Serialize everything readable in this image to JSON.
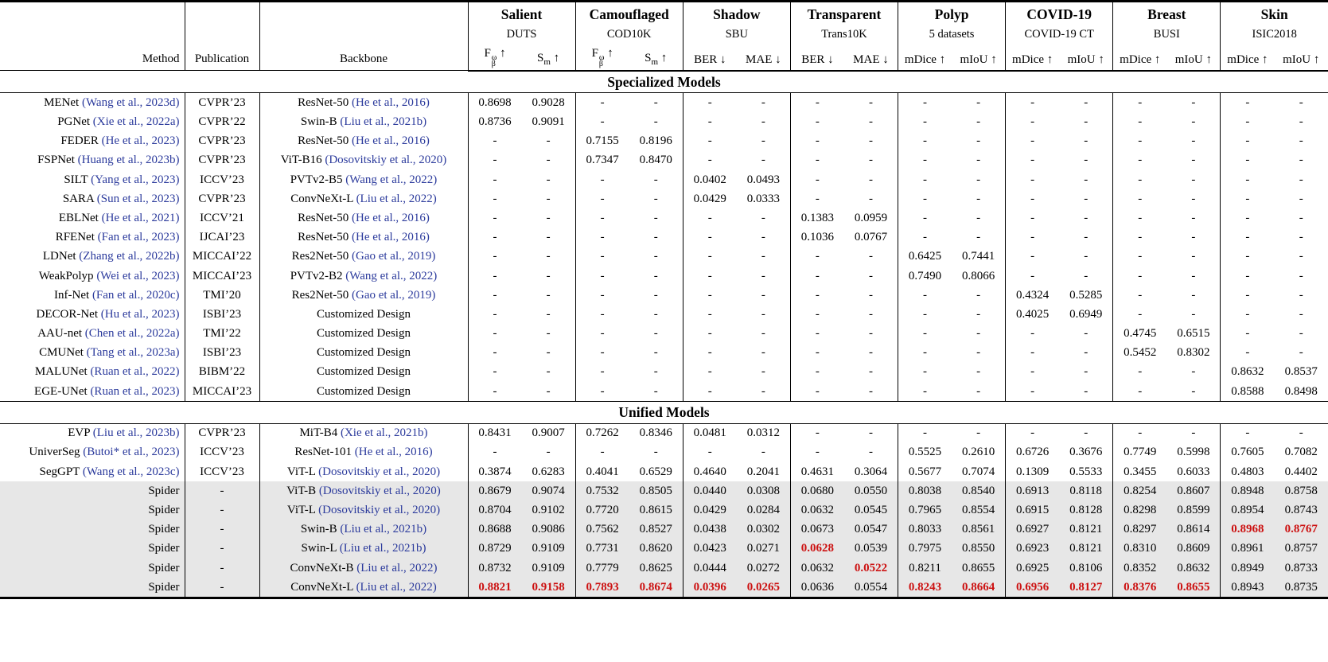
{
  "colors": {
    "cite": "#2b3a9c",
    "red": "#cc1111",
    "highlight": "#e7e7e7"
  },
  "table": {
    "left_columns": [
      {
        "label": "Method"
      },
      {
        "label": "Publication"
      },
      {
        "label": "Backbone"
      }
    ],
    "groups": [
      {
        "task": "Salient",
        "dataset": "DUTS",
        "metrics": [
          {
            "t": "F",
            "sub": "β",
            "sup": "ω",
            "arrow": "↑"
          },
          {
            "t": "S",
            "sub": "m",
            "arrow": "↑"
          }
        ]
      },
      {
        "task": "Camouflaged",
        "dataset": "COD10K",
        "metrics": [
          {
            "t": "F",
            "sub": "β",
            "sup": "ω",
            "arrow": "↑"
          },
          {
            "t": "S",
            "sub": "m",
            "arrow": "↑"
          }
        ]
      },
      {
        "task": "Shadow",
        "dataset": "SBU",
        "metrics": [
          {
            "t": "BER",
            "arrow": "↓"
          },
          {
            "t": "MAE",
            "arrow": "↓"
          }
        ]
      },
      {
        "task": "Transparent",
        "dataset": "Trans10K",
        "metrics": [
          {
            "t": "BER",
            "arrow": "↓"
          },
          {
            "t": "MAE",
            "arrow": "↓"
          }
        ]
      },
      {
        "task": "Polyp",
        "dataset": "5 datasets",
        "metrics": [
          {
            "t": "mDice",
            "arrow": "↑"
          },
          {
            "t": "mIoU",
            "arrow": "↑"
          }
        ]
      },
      {
        "task": "COVID-19",
        "dataset": "COVID-19 CT",
        "metrics": [
          {
            "t": "mDice",
            "arrow": "↑"
          },
          {
            "t": "mIoU",
            "arrow": "↑"
          }
        ]
      },
      {
        "task": "Breast",
        "dataset": "BUSI",
        "metrics": [
          {
            "t": "mDice",
            "arrow": "↑"
          },
          {
            "t": "mIoU",
            "arrow": "↑"
          }
        ]
      },
      {
        "task": "Skin",
        "dataset": "ISIC2018",
        "metrics": [
          {
            "t": "mDice",
            "arrow": "↑"
          },
          {
            "t": "mIoU",
            "arrow": "↑"
          }
        ]
      }
    ],
    "sections": [
      {
        "title": "Specialized Models",
        "rows": [
          {
            "method": "MENet",
            "method_cite": "(Wang et al., 2023d)",
            "pub": "CVPR’23",
            "backbone": "ResNet-50",
            "backbone_cite": "(He et al., 2016)",
            "values": [
              "0.8698",
              "0.9028",
              "-",
              "-",
              "-",
              "-",
              "-",
              "-",
              "-",
              "-",
              "-",
              "-",
              "-",
              "-",
              "-",
              "-"
            ]
          },
          {
            "method": "PGNet",
            "method_cite": "(Xie et al., 2022a)",
            "pub": "CVPR’22",
            "backbone": "Swin-B",
            "backbone_cite": "(Liu et al., 2021b)",
            "values": [
              "0.8736",
              "0.9091",
              "-",
              "-",
              "-",
              "-",
              "-",
              "-",
              "-",
              "-",
              "-",
              "-",
              "-",
              "-",
              "-",
              "-"
            ]
          },
          {
            "method": "FEDER",
            "method_cite": "(He et al., 2023)",
            "pub": "CVPR’23",
            "backbone": "ResNet-50",
            "backbone_cite": "(He et al., 2016)",
            "values": [
              "-",
              "-",
              "0.7155",
              "0.8196",
              "-",
              "-",
              "-",
              "-",
              "-",
              "-",
              "-",
              "-",
              "-",
              "-",
              "-",
              "-"
            ]
          },
          {
            "method": "FSPNet",
            "method_cite": "(Huang et al., 2023b)",
            "pub": "CVPR’23",
            "backbone": "ViT-B16",
            "backbone_cite": "(Dosovitskiy et al., 2020)",
            "values": [
              "-",
              "-",
              "0.7347",
              "0.8470",
              "-",
              "-",
              "-",
              "-",
              "-",
              "-",
              "-",
              "-",
              "-",
              "-",
              "-",
              "-"
            ]
          },
          {
            "method": "SILT",
            "method_cite": "(Yang et al., 2023)",
            "pub": "ICCV’23",
            "backbone": "PVTv2-B5",
            "backbone_cite": "(Wang et al., 2022)",
            "values": [
              "-",
              "-",
              "-",
              "-",
              "0.0402",
              "0.0493",
              "-",
              "-",
              "-",
              "-",
              "-",
              "-",
              "-",
              "-",
              "-",
              "-"
            ]
          },
          {
            "method": "SARA",
            "method_cite": "(Sun et al., 2023)",
            "pub": "CVPR’23",
            "backbone": "ConvNeXt-L",
            "backbone_cite": "(Liu et al., 2022)",
            "values": [
              "-",
              "-",
              "-",
              "-",
              "0.0429",
              "0.0333",
              "-",
              "-",
              "-",
              "-",
              "-",
              "-",
              "-",
              "-",
              "-",
              "-"
            ]
          },
          {
            "method": "EBLNet",
            "method_cite": "(He et al., 2021)",
            "pub": "ICCV’21",
            "backbone": "ResNet-50",
            "backbone_cite": "(He et al., 2016)",
            "values": [
              "-",
              "-",
              "-",
              "-",
              "-",
              "-",
              "0.1383",
              "0.0959",
              "-",
              "-",
              "-",
              "-",
              "-",
              "-",
              "-",
              "-"
            ]
          },
          {
            "method": "RFENet",
            "method_cite": "(Fan et al., 2023)",
            "pub": "IJCAI’23",
            "backbone": "ResNet-50",
            "backbone_cite": "(He et al., 2016)",
            "values": [
              "-",
              "-",
              "-",
              "-",
              "-",
              "-",
              "0.1036",
              "0.0767",
              "-",
              "-",
              "-",
              "-",
              "-",
              "-",
              "-",
              "-"
            ]
          },
          {
            "method": "LDNet",
            "method_cite": "(Zhang et al., 2022b)",
            "pub": "MICCAI’22",
            "backbone": "Res2Net-50",
            "backbone_cite": "(Gao et al., 2019)",
            "values": [
              "-",
              "-",
              "-",
              "-",
              "-",
              "-",
              "-",
              "-",
              "0.6425",
              "0.7441",
              "-",
              "-",
              "-",
              "-",
              "-",
              "-"
            ]
          },
          {
            "method": "WeakPolyp",
            "method_cite": "(Wei et al., 2023)",
            "pub": "MICCAI’23",
            "backbone": "PVTv2-B2",
            "backbone_cite": "(Wang et al., 2022)",
            "values": [
              "-",
              "-",
              "-",
              "-",
              "-",
              "-",
              "-",
              "-",
              "0.7490",
              "0.8066",
              "-",
              "-",
              "-",
              "-",
              "-",
              "-"
            ]
          },
          {
            "method": "Inf-Net",
            "method_cite": "(Fan et al., 2020c)",
            "pub": "TMI’20",
            "backbone": "Res2Net-50",
            "backbone_cite": "(Gao et al., 2019)",
            "values": [
              "-",
              "-",
              "-",
              "-",
              "-",
              "-",
              "-",
              "-",
              "-",
              "-",
              "0.4324",
              "0.5285",
              "-",
              "-",
              "-",
              "-"
            ]
          },
          {
            "method": "DECOR-Net",
            "method_cite": "(Hu et al., 2023)",
            "pub": "ISBI’23",
            "backbone": "Customized Design",
            "backbone_cite": "",
            "values": [
              "-",
              "-",
              "-",
              "-",
              "-",
              "-",
              "-",
              "-",
              "-",
              "-",
              "0.4025",
              "0.6949",
              "-",
              "-",
              "-",
              "-"
            ]
          },
          {
            "method": "AAU-net",
            "method_cite": "(Chen et al., 2022a)",
            "pub": "TMI’22",
            "backbone": "Customized Design",
            "backbone_cite": "",
            "values": [
              "-",
              "-",
              "-",
              "-",
              "-",
              "-",
              "-",
              "-",
              "-",
              "-",
              "-",
              "-",
              "0.4745",
              "0.6515",
              "-",
              "-"
            ]
          },
          {
            "method": "CMUNet",
            "method_cite": "(Tang et al., 2023a)",
            "pub": "ISBI’23",
            "backbone": "Customized Design",
            "backbone_cite": "",
            "values": [
              "-",
              "-",
              "-",
              "-",
              "-",
              "-",
              "-",
              "-",
              "-",
              "-",
              "-",
              "-",
              "0.5452",
              "0.8302",
              "-",
              "-"
            ]
          },
          {
            "method": "MALUNet",
            "method_cite": "(Ruan et al., 2022)",
            "pub": "BIBM’22",
            "backbone": "Customized Design",
            "backbone_cite": "",
            "values": [
              "-",
              "-",
              "-",
              "-",
              "-",
              "-",
              "-",
              "-",
              "-",
              "-",
              "-",
              "-",
              "-",
              "-",
              "0.8632",
              "0.8537"
            ]
          },
          {
            "method": "EGE-UNet",
            "method_cite": "(Ruan et al., 2023)",
            "pub": "MICCAI’23",
            "backbone": "Customized Design",
            "backbone_cite": "",
            "values": [
              "-",
              "-",
              "-",
              "-",
              "-",
              "-",
              "-",
              "-",
              "-",
              "-",
              "-",
              "-",
              "-",
              "-",
              "0.8588",
              "0.8498"
            ]
          }
        ]
      },
      {
        "title": "Unified Models",
        "rows": [
          {
            "method": "EVP",
            "method_cite": "(Liu et al., 2023b)",
            "pub": "CVPR’23",
            "backbone": "MiT-B4",
            "backbone_cite": "(Xie et al., 2021b)",
            "values": [
              "0.8431",
              "0.9007",
              "0.7262",
              "0.8346",
              "0.0481",
              "0.0312",
              "-",
              "-",
              "-",
              "-",
              "-",
              "-",
              "-",
              "-",
              "-",
              "-"
            ]
          },
          {
            "method": "UniverSeg",
            "method_cite": "(Butoi* et al., 2023)",
            "pub": "ICCV’23",
            "backbone": "ResNet-101",
            "backbone_cite": "(He et al., 2016)",
            "values": [
              "-",
              "-",
              "-",
              "-",
              "-",
              "-",
              "-",
              "-",
              "0.5525",
              "0.2610",
              "0.6726",
              "0.3676",
              "0.7749",
              "0.5998",
              "0.7605",
              "0.7082"
            ]
          },
          {
            "method": "SegGPT",
            "method_cite": "(Wang et al., 2023c)",
            "pub": "ICCV’23",
            "backbone": "ViT-L",
            "backbone_cite": "(Dosovitskiy et al., 2020)",
            "values": [
              "0.3874",
              "0.6283",
              "0.4041",
              "0.6529",
              "0.4640",
              "0.2041",
              "0.4631",
              "0.3064",
              "0.5677",
              "0.7074",
              "0.1309",
              "0.5533",
              "0.3455",
              "0.6033",
              "0.4803",
              "0.4402"
            ]
          },
          {
            "method": "Spider",
            "method_cite": "",
            "pub": "-",
            "backbone": "ViT-B",
            "backbone_cite": "(Dosovitskiy et al., 2020)",
            "highlight": true,
            "values": [
              "0.8679",
              "0.9074",
              "0.7532",
              "0.8505",
              "0.0440",
              "0.0308",
              "0.0680",
              "0.0550",
              "0.8038",
              "0.8540",
              "0.6913",
              "0.8118",
              "0.8254",
              "0.8607",
              "0.8948",
              "0.8758"
            ]
          },
          {
            "method": "Spider",
            "method_cite": "",
            "pub": "-",
            "backbone": "ViT-L",
            "backbone_cite": "(Dosovitskiy et al., 2020)",
            "highlight": true,
            "values": [
              "0.8704",
              "0.9102",
              "0.7720",
              "0.8615",
              "0.0429",
              "0.0284",
              "0.0632",
              "0.0545",
              "0.7965",
              "0.8554",
              "0.6915",
              "0.8128",
              "0.8298",
              "0.8599",
              "0.8954",
              "0.8743"
            ]
          },
          {
            "method": "Spider",
            "method_cite": "",
            "pub": "-",
            "backbone": "Swin-B",
            "backbone_cite": "(Liu et al., 2021b)",
            "highlight": true,
            "red": [
              14,
              15
            ],
            "values": [
              "0.8688",
              "0.9086",
              "0.7562",
              "0.8527",
              "0.0438",
              "0.0302",
              "0.0673",
              "0.0547",
              "0.8033",
              "0.8561",
              "0.6927",
              "0.8121",
              "0.8297",
              "0.8614",
              "0.8968",
              "0.8767"
            ]
          },
          {
            "method": "Spider",
            "method_cite": "",
            "pub": "-",
            "backbone": "Swin-L",
            "backbone_cite": "(Liu et al., 2021b)",
            "highlight": true,
            "red": [
              6
            ],
            "values": [
              "0.8729",
              "0.9109",
              "0.7731",
              "0.8620",
              "0.0423",
              "0.0271",
              "0.0628",
              "0.0539",
              "0.7975",
              "0.8550",
              "0.6923",
              "0.8121",
              "0.8310",
              "0.8609",
              "0.8961",
              "0.8757"
            ]
          },
          {
            "method": "Spider",
            "method_cite": "",
            "pub": "-",
            "backbone": "ConvNeXt-B",
            "backbone_cite": "(Liu et al., 2022)",
            "highlight": true,
            "red": [
              7
            ],
            "values": [
              "0.8732",
              "0.9109",
              "0.7779",
              "0.8625",
              "0.0444",
              "0.0272",
              "0.0632",
              "0.0522",
              "0.8211",
              "0.8655",
              "0.6925",
              "0.8106",
              "0.8352",
              "0.8632",
              "0.8949",
              "0.8733"
            ]
          },
          {
            "method": "Spider",
            "method_cite": "",
            "pub": "-",
            "backbone": "ConvNeXt-L",
            "backbone_cite": "(Liu et al., 2022)",
            "highlight": true,
            "red": [
              0,
              1,
              2,
              3,
              4,
              5,
              8,
              9,
              10,
              11,
              12,
              13
            ],
            "values": [
              "0.8821",
              "0.9158",
              "0.7893",
              "0.8674",
              "0.0396",
              "0.0265",
              "0.0636",
              "0.0554",
              "0.8243",
              "0.8664",
              "0.6956",
              "0.8127",
              "0.8376",
              "0.8655",
              "0.8943",
              "0.8735"
            ]
          }
        ]
      }
    ]
  }
}
